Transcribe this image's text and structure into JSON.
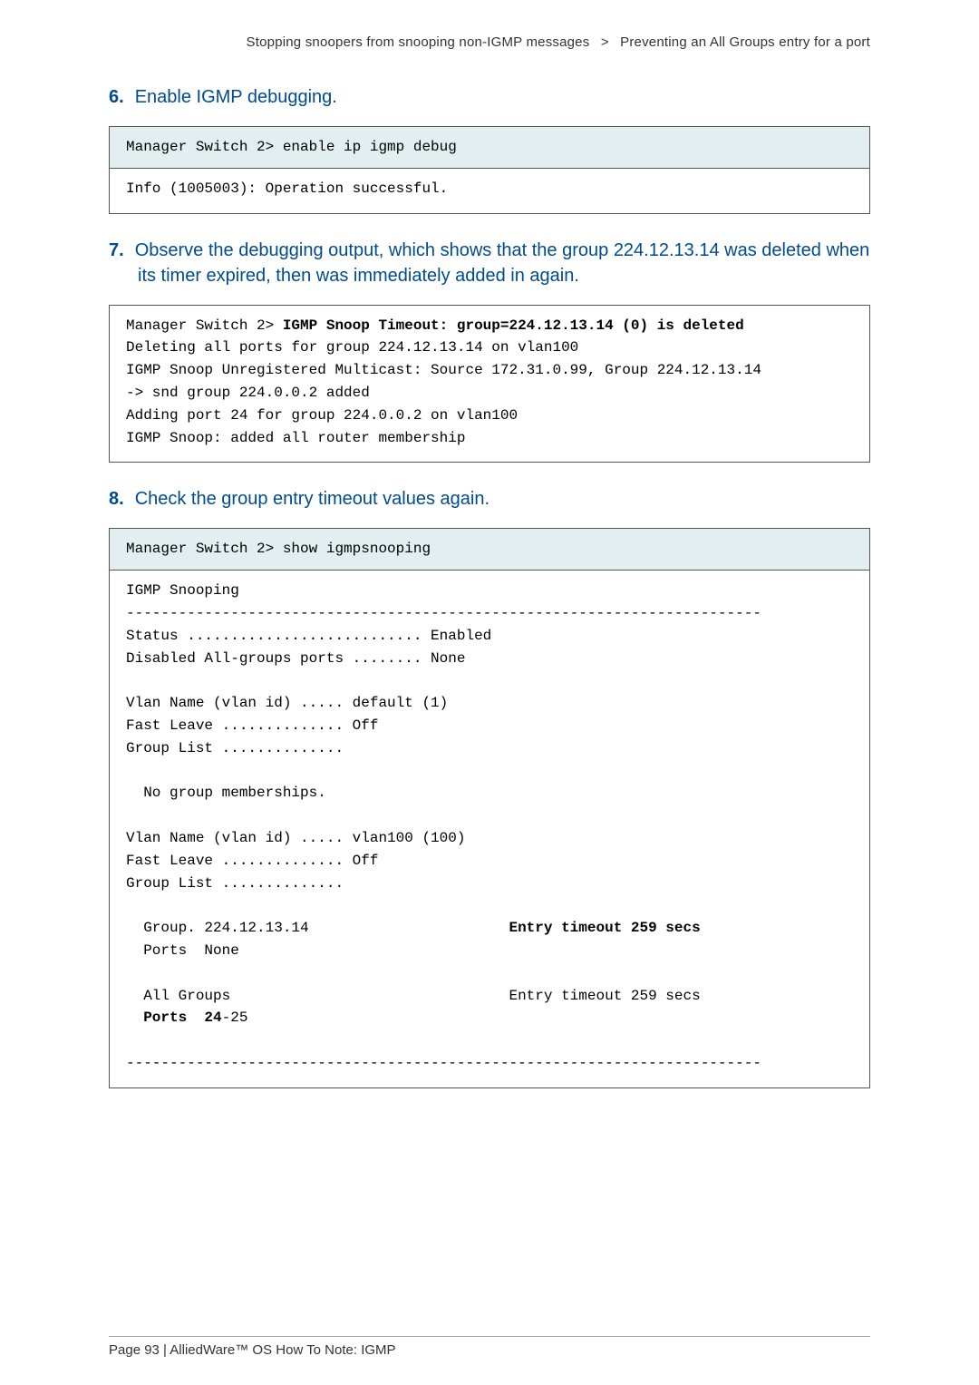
{
  "header": {
    "left": "Stopping snoopers from snooping non-IGMP messages",
    "sep": ">",
    "right": "Preventing an All Groups entry for a port"
  },
  "steps": {
    "s6": {
      "num": "6.",
      "title": "Enable IGMP debugging."
    },
    "s7": {
      "num": "7.",
      "title": "Observe the debugging output, which shows that the group 224.12.13.14 was deleted when its timer expired, then was immediately added in again."
    },
    "s8": {
      "num": "8.",
      "title": "Check the group entry timeout values again."
    }
  },
  "box6": {
    "cmd": "Manager Switch 2> enable ip igmp debug",
    "out": "Info (1005003): Operation successful."
  },
  "box7": {
    "l1a": "Manager Switch 2> ",
    "l1b": "IGMP Snoop Timeout: group=224.12.13.14 (0) is deleted",
    "l2": "Deleting all ports for group 224.12.13.14 on vlan100",
    "l3": "IGMP Snoop Unregistered Multicast: Source 172.31.0.99, Group 224.12.13.14",
    "l4": "-> snd group 224.0.0.2 added",
    "l5": "Adding port 24 for group 224.0.0.2 on vlan100",
    "l6": "IGMP Snoop: added all router membership"
  },
  "box8": {
    "cmd": "Manager Switch 2> show igmpsnooping",
    "l1": "IGMP Snooping",
    "l2": "-------------------------------------------------------------------------",
    "l3": "Status ........................... Enabled",
    "l4": "Disabled All-groups ports ........ None",
    "l5": "",
    "l6": "Vlan Name (vlan id) ..... default (1)",
    "l7": "Fast Leave .............. Off",
    "l8": "Group List ..............",
    "l9": "",
    "l10": "  No group memberships.",
    "l11": "",
    "l12": "Vlan Name (vlan id) ..... vlan100 (100)",
    "l13": "Fast Leave .............. Off",
    "l14": "Group List ..............",
    "l15": "",
    "l16a": "  Group. 224.12.13.14                       ",
    "l16b": "Entry timeout 259 secs",
    "l17": "  Ports  None",
    "l18": "",
    "l19": "  All Groups                                Entry timeout 259 secs",
    "l20a": "  ",
    "l20b": "Ports  24",
    "l20c": "-25",
    "l21": "",
    "l22": "-------------------------------------------------------------------------"
  },
  "footer": "Page 93 | AlliedWare™ OS How To Note: IGMP"
}
